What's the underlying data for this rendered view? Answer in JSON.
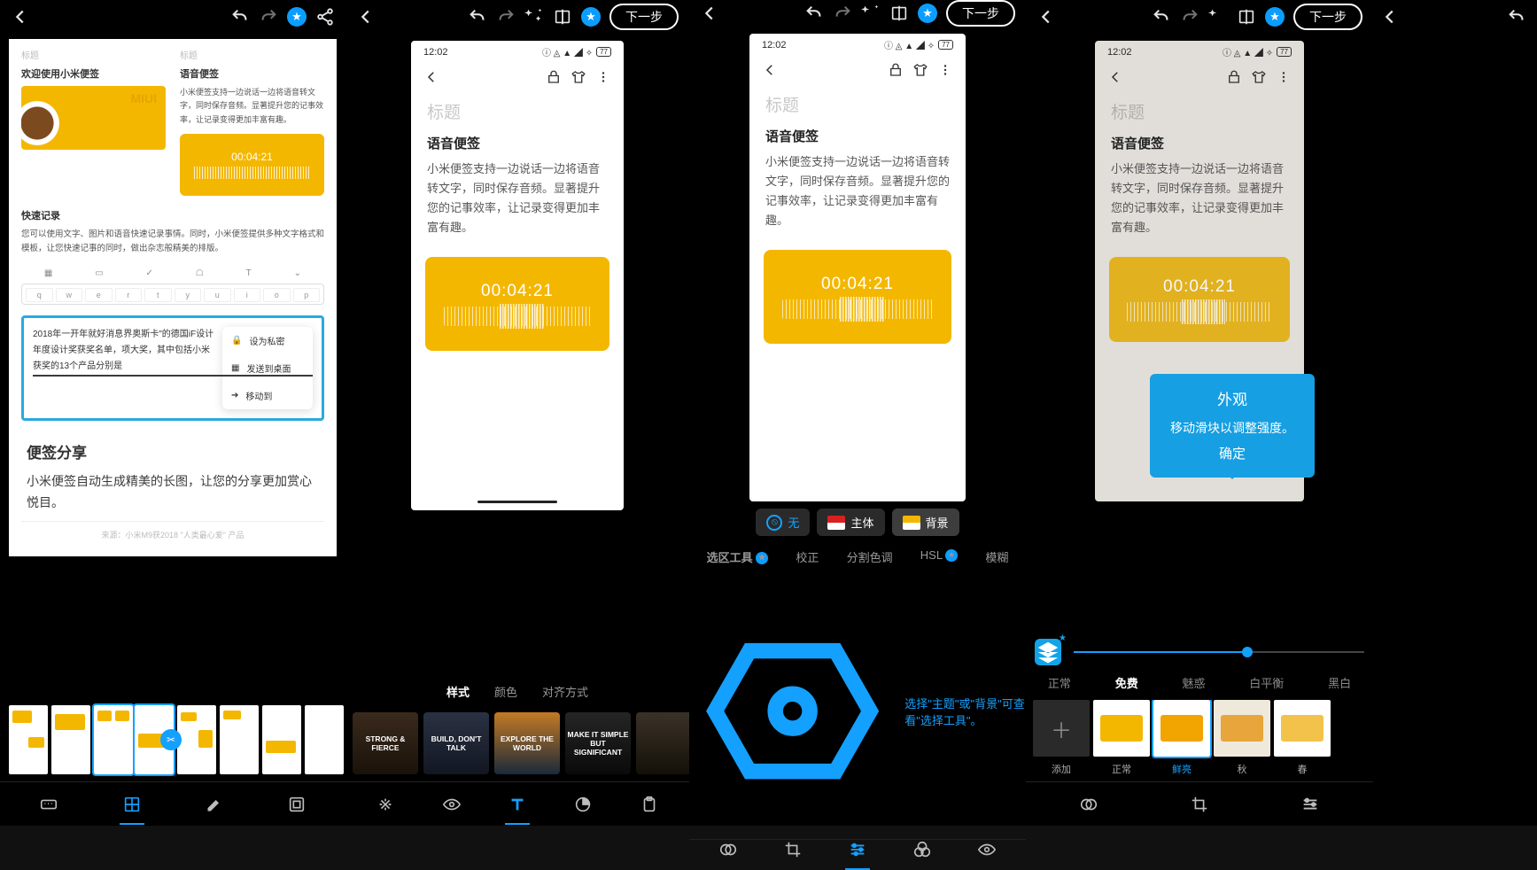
{
  "common": {
    "next": "下一步",
    "status_time": "12:02",
    "battery": "77",
    "title_placeholder": "标题",
    "voice_note": "语音便签",
    "voice_body": "小米便签支持一边说话一边将语音转文字，同时保存音频。显著提升您的记事效率，让记录变得更加丰富有趣。",
    "audio_time": "00:04:21"
  },
  "p1": {
    "doc": {
      "welcome": "欢迎使用小米便签",
      "miui": "MIUI",
      "quick_rec": "快速记录",
      "quick_body": "您可以使用文字、图片和语音快速记录事情。同时，小米便签提供多种文字格式和模板，让您快速记事的同时，做出杂志般精美的排版。",
      "voice_desc": "小米便签支持一边说话一边将语音转文字，同时保存音频。显著提升您的记事效率，让记录变得更加丰富有趣。",
      "popover_txt": "2018年一开年就好消息界奥斯卡\"的德国iF设计年度设计奖获奖名单，项大奖，其中包括小米获奖的13个产品分别是",
      "menu": {
        "a": "设为私密",
        "b": "发送到桌面",
        "c": "移动到"
      },
      "share_h": "便签分享",
      "share_p": "小米便签自动生成精美的长图，让您的分享更加赏心悦目。",
      "footer_hint": "来源：小米M9获2018 \"人类最心爱\" 产品"
    }
  },
  "p2": {
    "tabs": {
      "a": "样式",
      "b": "颜色",
      "c": "对齐方式"
    },
    "styles": [
      "STRONG & FIERCE",
      "BUILD, DON'T TALK",
      "EXPLORE THE WORLD",
      "MAKE IT SIMPLE BUT SIGNIFICANT",
      ""
    ]
  },
  "p3": {
    "chips": {
      "none": "无",
      "subject": "主体",
      "bg": "背景"
    },
    "hint": "选择\"主题\"或\"背景\"可查看\"选择工具\"。",
    "tabs": {
      "a": "选区工具",
      "b": "校正",
      "c": "分割色调",
      "d": "HSL",
      "e": "模糊"
    }
  },
  "p4": {
    "tooltip": {
      "title": "外观",
      "body": "移动滑块以调整强度。",
      "ok": "确定"
    },
    "tabs": {
      "a": "正常",
      "b": "免费",
      "c": "魅惑",
      "d": "白平衡",
      "e": "黑白"
    },
    "filters": {
      "add": "添加",
      "normal": "正常",
      "vivid": "鲜亮",
      "autumn": "秋",
      "spring": "春"
    }
  },
  "icons": {
    "back": "←",
    "undo": "↶",
    "redo": "↷",
    "share": "➦",
    "magic": "✧",
    "compare": "◧",
    "star": "★",
    "ratio": "▣",
    "pencil": "✎",
    "frame": "▢",
    "fx": "✕",
    "eye": "👁",
    "text": "T",
    "sticker": "◔",
    "paste": "📋",
    "blur": "◐",
    "crop": "✂",
    "adjust": "≡",
    "filters": "⊚",
    "layers": "≣"
  }
}
